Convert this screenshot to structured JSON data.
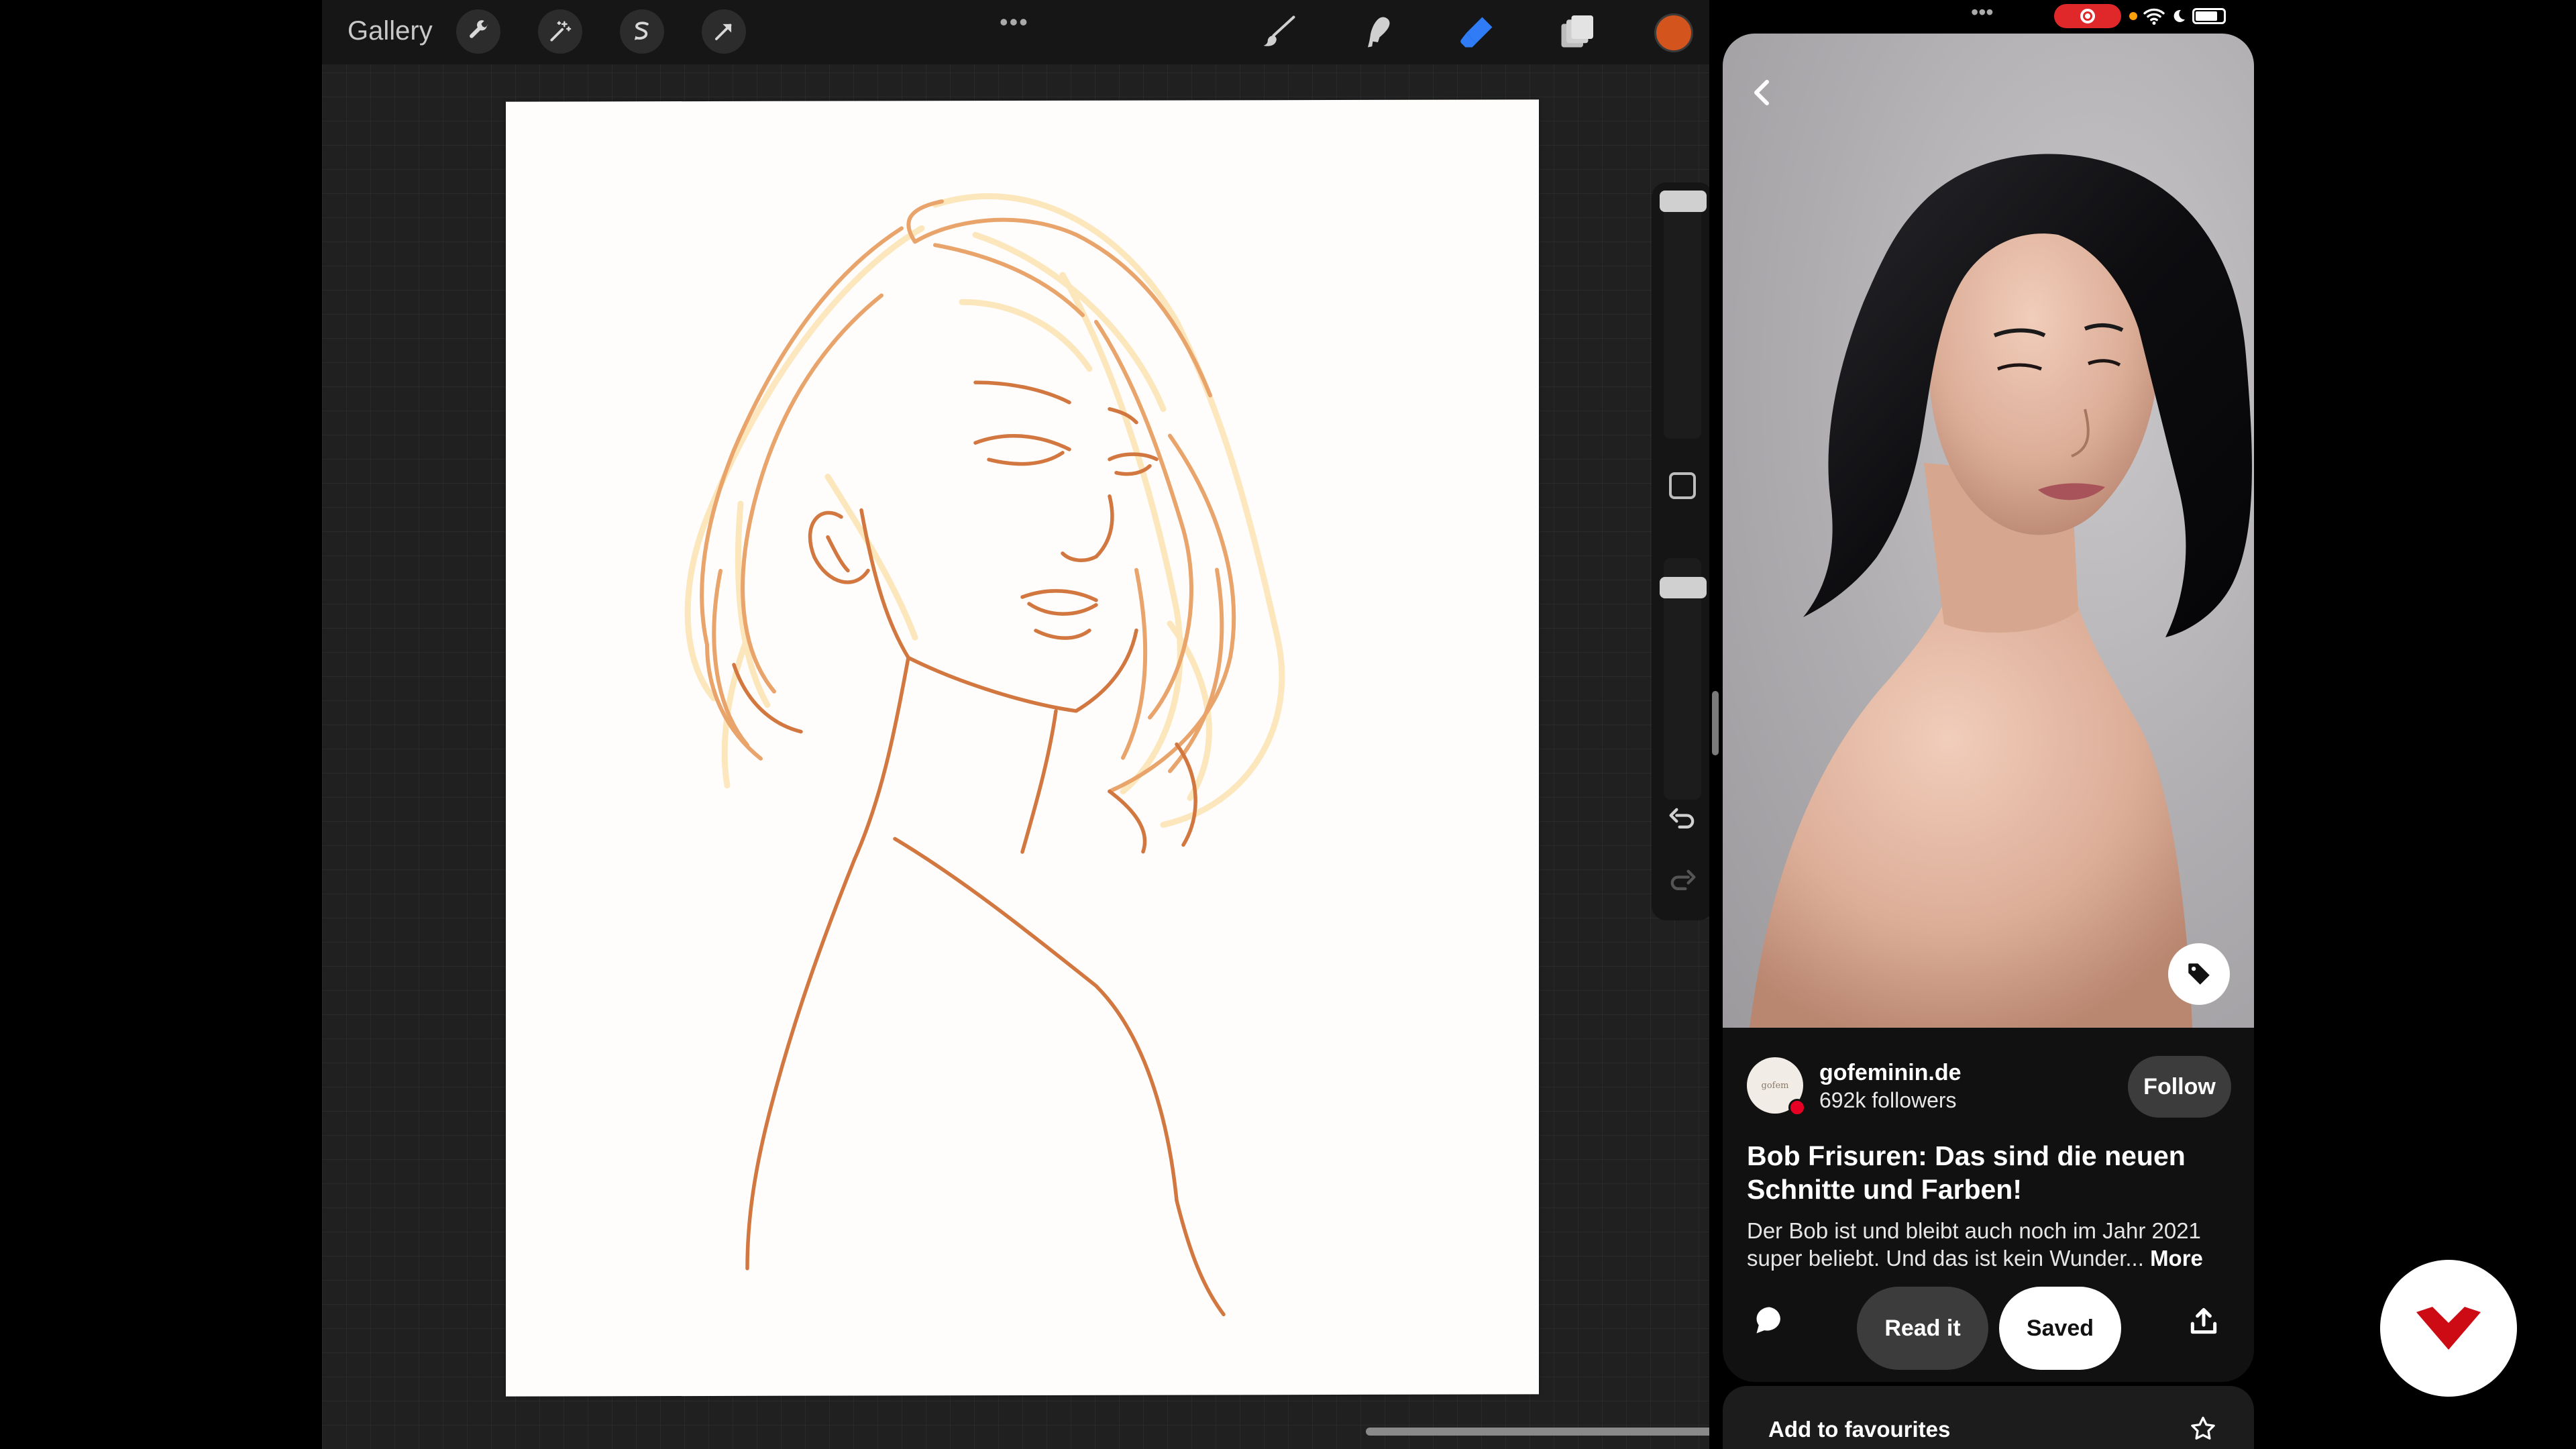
{
  "procreate": {
    "gallery_label": "Gallery",
    "more_dots": "•••",
    "tools": [
      "wrench-icon",
      "magic-wand-icon",
      "selection-icon",
      "transform-arrow-icon",
      "brush-icon",
      "smudge-icon",
      "eraser-icon",
      "layers-icon"
    ],
    "active_tool": "eraser",
    "active_color": "#d4541e",
    "accent_color": "#2f7cf6"
  },
  "pinterest": {
    "status_dots": "•••",
    "record_color": "#e0282b",
    "creator": {
      "name": "gofeminin.de",
      "followers": "692k followers",
      "avatar_text": "gofem"
    },
    "follow_label": "Follow",
    "pin_title": "Bob Frisuren: Das sind die neuen Schnitte und Farben!",
    "pin_description": "Der Bob ist und bleibt auch noch im Jahr 2021 super beliebt. Und das ist kein Wunder...",
    "more_label": "More",
    "read_label": "Read it",
    "saved_label": "Saved",
    "favourites_label": "Add to favourites",
    "brand_red": "#e60023"
  },
  "watermark": {
    "icon": "red-chevron-logo",
    "color": "#cc0b14"
  }
}
